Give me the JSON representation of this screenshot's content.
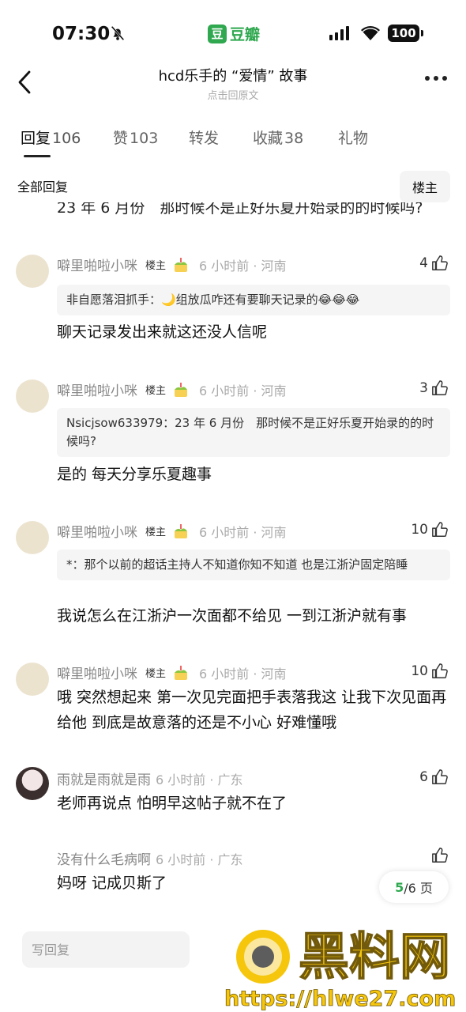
{
  "status_bar": {
    "time": "07:30",
    "app_name": "豆瓣",
    "app_badge": "豆",
    "battery": "100"
  },
  "header": {
    "title": "hcd乐手的 “爱情” 故事",
    "subtitle": "点击回原文"
  },
  "tabs": [
    {
      "label": "回复",
      "count": "106",
      "active": true
    },
    {
      "label": "赞",
      "count": "103"
    },
    {
      "label": "转发",
      "count": ""
    },
    {
      "label": "收藏",
      "count": "38"
    },
    {
      "label": "礼物",
      "count": ""
    }
  ],
  "filter": {
    "label": "全部回复",
    "owner_button": "楼主"
  },
  "clipped_line": "23 年 6 月份　那时候不是正好乐夏开始录的的时候吗?",
  "comments": [
    {
      "user": "噼里啪啦小咪",
      "owner_tag": "楼主",
      "time": "6 小时前 · 河南",
      "likes": "4",
      "quote": "非自愿落泪抓手：🌙组放瓜咋还有要聊天记录的😂😂😂",
      "body": "聊天记录发出来就这还没人信呢"
    },
    {
      "user": "噼里啪啦小咪",
      "owner_tag": "楼主",
      "time": "6 小时前 · 河南",
      "likes": "3",
      "quote": "Nsicjsow633979：23 年 6 月份　那时候不是正好乐夏开始录的的时候吗?",
      "body": "是的 每天分享乐夏趣事"
    },
    {
      "user": "噼里啪啦小咪",
      "owner_tag": "楼主",
      "time": "6 小时前 · 河南",
      "likes": "10",
      "quote": "*：那个以前的超话主持人不知道你知不知道 也是江浙沪固定陪睡",
      "body": "我说怎么在江浙沪一次面都不给见 一到江浙沪就有事"
    },
    {
      "user": "噼里啪啦小咪",
      "owner_tag": "楼主",
      "time": "6 小时前 · 河南",
      "likes": "10",
      "quote": "",
      "body": "哦 突然想起来 第一次见完面把手表落我这 让我下次见面再给他 到底是故意落的还是不小心 好难懂哦"
    },
    {
      "user": "雨就是雨就是雨",
      "owner_tag": "",
      "time": "6 小时前 · 广东",
      "likes": "6",
      "quote": "",
      "body": "老师再说点 怕明早这帖子就不在了"
    },
    {
      "user": "没有什么毛病啊",
      "owner_tag": "",
      "time": "6 小时前 · 广东",
      "likes": "",
      "quote": "",
      "body": "妈呀 记成贝斯了"
    }
  ],
  "pager": {
    "current": "5",
    "total_text": "/6 页"
  },
  "reply_box": {
    "placeholder": "写回复"
  },
  "watermark": {
    "brand": "黑料网",
    "url": "https://hlwe27.com"
  },
  "colors": {
    "accent_green": "#2fa84f",
    "watermark_yellow": "#f5c400"
  }
}
